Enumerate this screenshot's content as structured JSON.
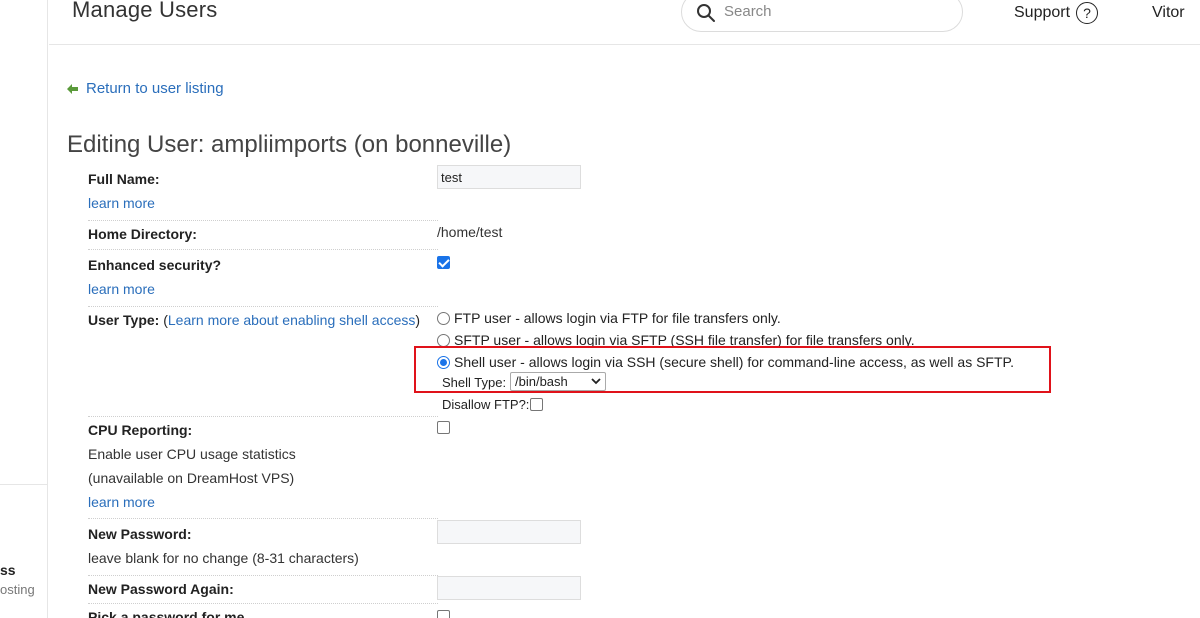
{
  "sidebar": {
    "fragment_1": "ss",
    "fragment_2": "osting"
  },
  "header": {
    "title": "Manage Users",
    "search_placeholder": "Search",
    "support_label": "Support",
    "help_glyph": "?",
    "user_name": "Vitor"
  },
  "back_link": "Return to user listing",
  "edit_title": "Editing User: ampliimports (on bonneville)",
  "form": {
    "full_name": {
      "label": "Full Name:",
      "value": "test",
      "learn_more": "learn more"
    },
    "home_directory": {
      "label": "Home Directory:",
      "value": "/home/test"
    },
    "enhanced_security": {
      "label": "Enhanced security?",
      "checked": true,
      "learn_more": "learn more"
    },
    "user_type": {
      "label": "User Type:",
      "paren_open": "(",
      "learn_link": "Learn more about enabling shell access",
      "paren_close": ")",
      "options": [
        {
          "label": "FTP user - allows login via FTP for file transfers only.",
          "selected": false
        },
        {
          "label": "SFTP user - allows login via SFTP (SSH file transfer) for file transfers only.",
          "selected": false
        },
        {
          "label": "Shell user - allows login via SSH (secure shell) for command-line access, as well as SFTP.",
          "selected": true
        }
      ],
      "shell_type_label": "Shell Type:",
      "shell_type_value": "/bin/bash",
      "disallow_ftp_label": "Disallow FTP?:"
    },
    "cpu_reporting": {
      "label": "CPU Reporting:",
      "description_1": "Enable user CPU usage statistics",
      "description_2": "(unavailable on DreamHost VPS)",
      "learn_more": "learn more"
    },
    "new_password": {
      "label": "New Password:",
      "hint": "leave blank for no change (8-31 characters)"
    },
    "new_password_again": {
      "label": "New Password Again:"
    },
    "pick_password": {
      "label": "Pick a password for me"
    }
  },
  "colors": {
    "link": "#2a6ebb",
    "highlight": "#e0121a",
    "accent": "#1a73e8"
  },
  "icons": [
    "search-icon",
    "help-icon",
    "back-arrow-icon",
    "chevron-down-icon"
  ]
}
